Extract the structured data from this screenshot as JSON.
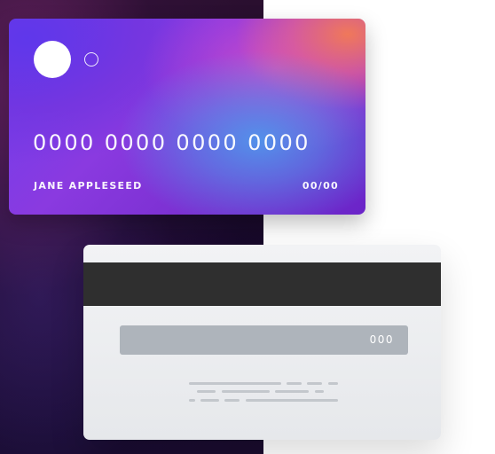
{
  "card_front": {
    "number": "0000 0000 0000 0000",
    "holder_name": "JANE APPLESEED",
    "expiry": "00/00"
  },
  "card_back": {
    "cvc": "000"
  },
  "colors": {
    "front_gradient_start": "#6a3ff0",
    "front_gradient_accent_pink": "#d750c8",
    "front_gradient_accent_orange": "#f0785a",
    "front_gradient_accent_blue": "#5096eb",
    "dark_background": "#1a0a2a",
    "magnetic_stripe": "#2f2f2f",
    "signature_strip": "#aeb4bb",
    "back_card": "#eceef1"
  }
}
